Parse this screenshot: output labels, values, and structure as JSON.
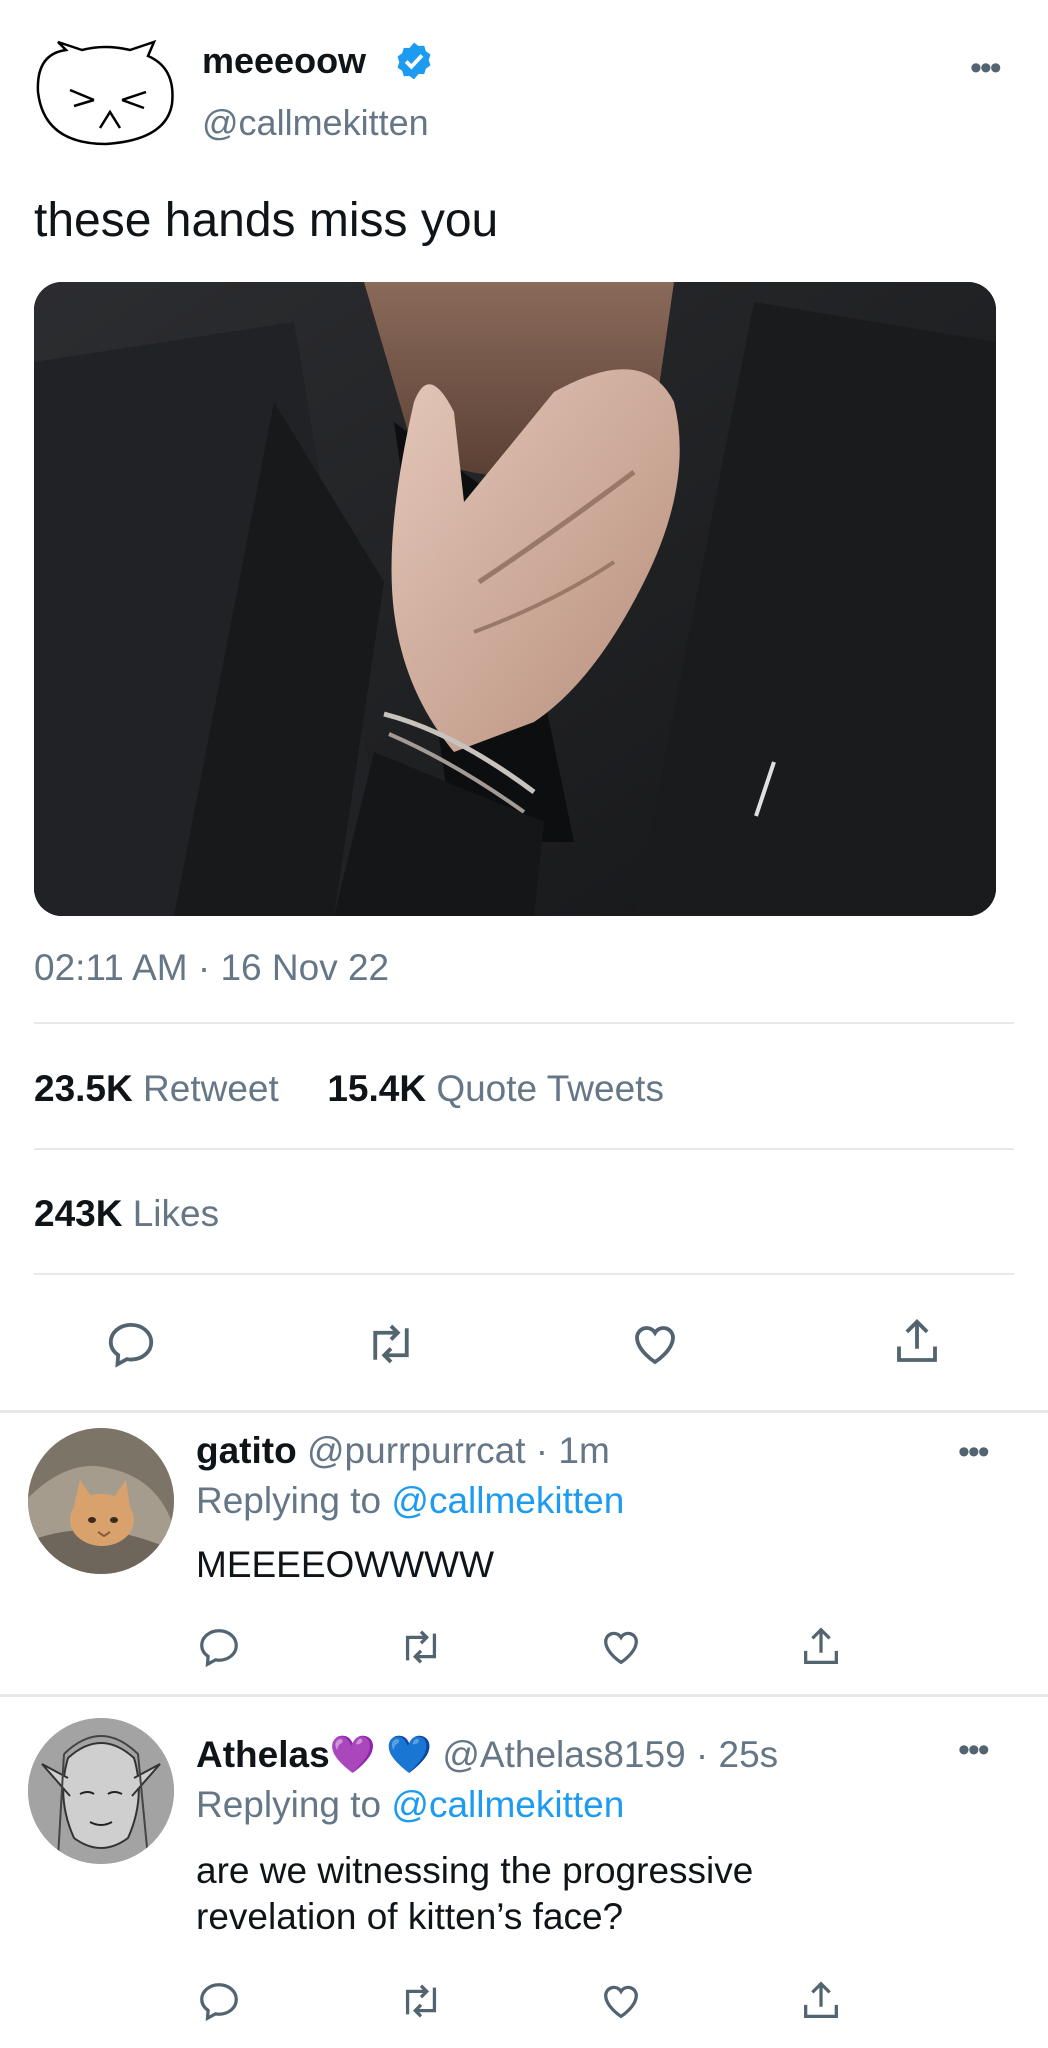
{
  "tweet": {
    "display_name": "meeeoow",
    "handle": "@callmekitten",
    "text": "these hands miss you",
    "timestamp": "02:11 AM · 16 Nov 22",
    "retweets_count": "23.5K",
    "retweets_label": "Retweet",
    "quotes_count": "15.4K",
    "quotes_label": "Quote Tweets",
    "likes_count": "243K",
    "likes_label": "Likes"
  },
  "replies": [
    {
      "display_name": "gatito",
      "handle_time": "@purrpurrcat · 1m",
      "replying_prefix": "Replying to",
      "replying_handle": "@callmekitten",
      "text": "MEEEEOWWWW"
    },
    {
      "display_name": "Athelas💜 💙",
      "handle_time": "@Athelas8159 · 25s",
      "replying_prefix": "Replying to",
      "replying_handle": "@callmekitten",
      "text_line1": "are we witnessing the progressive",
      "text_line2": "revelation of kitten’s face?"
    }
  ],
  "colors": {
    "accent": "#1d9bf0",
    "secondary_text": "#657786",
    "divider": "#e6e8ea"
  },
  "icons": [
    "cat-face-icon",
    "verified-badge-icon",
    "more-options-icon",
    "reply-icon",
    "retweet-icon",
    "like-icon",
    "share-icon"
  ]
}
